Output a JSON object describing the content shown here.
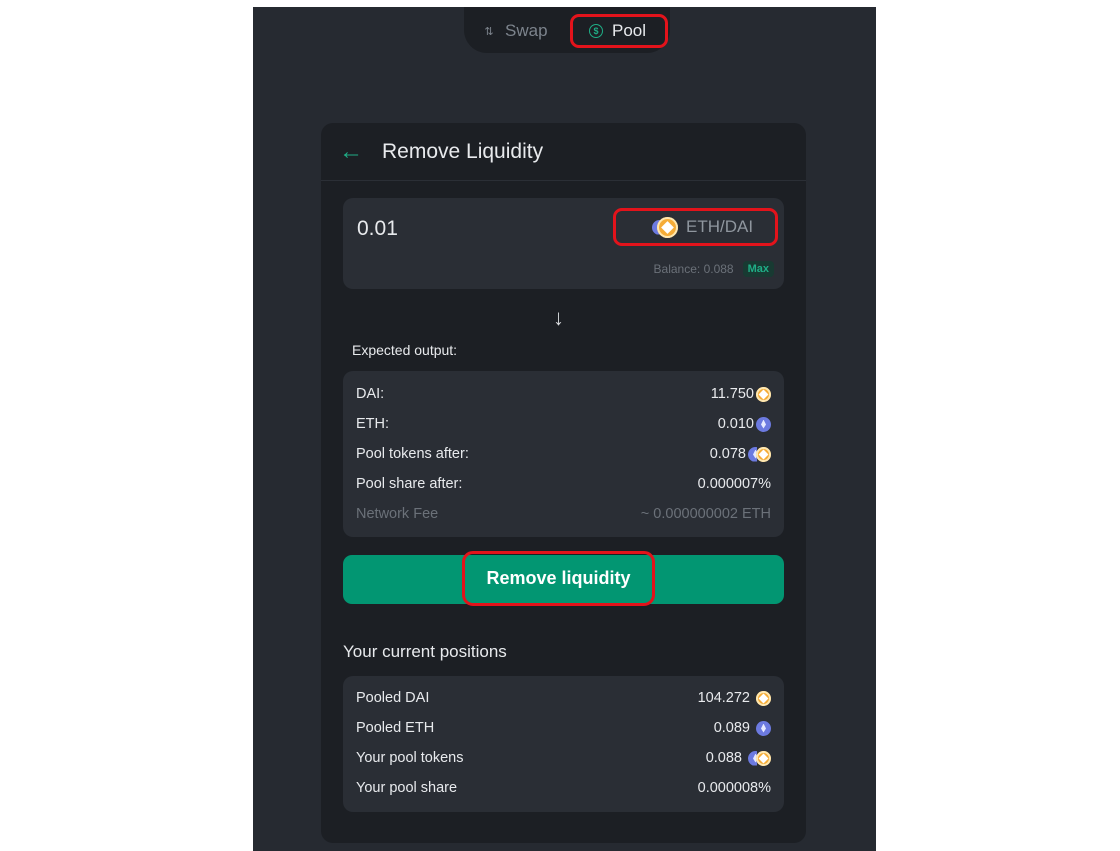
{
  "nav": {
    "swap_label": "Swap",
    "pool_label": "Pool"
  },
  "card": {
    "title": "Remove Liquidity",
    "amount_input": {
      "value": "0.01"
    },
    "token_select": {
      "label": "ETH/DAI",
      "icons": [
        "eth-icon",
        "dai-icon"
      ]
    },
    "balance_text": "Balance: 0.088",
    "max_label": "Max",
    "expected_output_label": "Expected output:",
    "output_rows": [
      {
        "label": "DAI:",
        "value": "11.750",
        "icon": "dai-icon"
      },
      {
        "label": "ETH:",
        "value": "0.010",
        "icon": "eth-icon"
      },
      {
        "label": "Pool tokens after:",
        "value": "0.078",
        "icon": "eth-dai-pair-icon"
      },
      {
        "label": "Pool share after:",
        "value": "0.000007%"
      },
      {
        "label": "Network Fee",
        "value": "~ 0.000000002 ETH"
      }
    ],
    "remove_button_label": "Remove liquidity",
    "positions_title": "Your current positions",
    "position_rows": [
      {
        "label": "Pooled DAI",
        "value": "104.272",
        "icon": "dai-icon"
      },
      {
        "label": "Pooled ETH",
        "value": "0.089",
        "icon": "eth-icon"
      },
      {
        "label": "Your pool tokens",
        "value": "0.088",
        "icon": "eth-dai-pair-icon"
      },
      {
        "label": "Your pool share",
        "value": "0.000008%"
      }
    ]
  },
  "colors": {
    "accent": "#1fae86",
    "button": "#029672",
    "highlight": "#e3131b",
    "background": "#262a31",
    "card": "#1c1f24",
    "panel": "#2a2e35"
  }
}
